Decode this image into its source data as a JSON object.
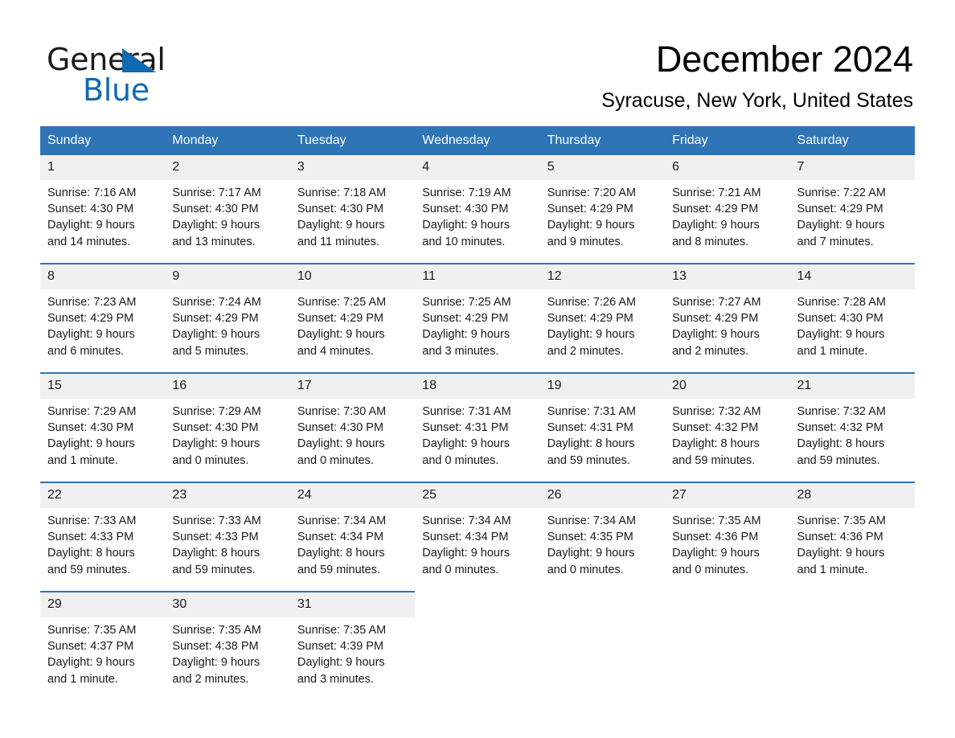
{
  "brand": {
    "name_top": "General",
    "name_bottom": "Blue",
    "triangle_color": "#1169b0",
    "text_color": "#1a1a1a"
  },
  "header": {
    "title": "December 2024",
    "subtitle": "Syracuse, New York, United States"
  },
  "theme": {
    "header_blue": "#2f74b5",
    "daynum_band": "#f0f0f0",
    "text": "#1a1a1a"
  },
  "weekday_headers": [
    "Sunday",
    "Monday",
    "Tuesday",
    "Wednesday",
    "Thursday",
    "Friday",
    "Saturday"
  ],
  "days": [
    {
      "date": "1",
      "sunrise": "Sunrise: 7:16 AM",
      "sunset": "Sunset: 4:30 PM",
      "daylight_line1": "Daylight: 9 hours",
      "daylight_line2": "and 14 minutes."
    },
    {
      "date": "2",
      "sunrise": "Sunrise: 7:17 AM",
      "sunset": "Sunset: 4:30 PM",
      "daylight_line1": "Daylight: 9 hours",
      "daylight_line2": "and 13 minutes."
    },
    {
      "date": "3",
      "sunrise": "Sunrise: 7:18 AM",
      "sunset": "Sunset: 4:30 PM",
      "daylight_line1": "Daylight: 9 hours",
      "daylight_line2": "and 11 minutes."
    },
    {
      "date": "4",
      "sunrise": "Sunrise: 7:19 AM",
      "sunset": "Sunset: 4:30 PM",
      "daylight_line1": "Daylight: 9 hours",
      "daylight_line2": "and 10 minutes."
    },
    {
      "date": "5",
      "sunrise": "Sunrise: 7:20 AM",
      "sunset": "Sunset: 4:29 PM",
      "daylight_line1": "Daylight: 9 hours",
      "daylight_line2": "and 9 minutes."
    },
    {
      "date": "6",
      "sunrise": "Sunrise: 7:21 AM",
      "sunset": "Sunset: 4:29 PM",
      "daylight_line1": "Daylight: 9 hours",
      "daylight_line2": "and 8 minutes."
    },
    {
      "date": "7",
      "sunrise": "Sunrise: 7:22 AM",
      "sunset": "Sunset: 4:29 PM",
      "daylight_line1": "Daylight: 9 hours",
      "daylight_line2": "and 7 minutes."
    },
    {
      "date": "8",
      "sunrise": "Sunrise: 7:23 AM",
      "sunset": "Sunset: 4:29 PM",
      "daylight_line1": "Daylight: 9 hours",
      "daylight_line2": "and 6 minutes."
    },
    {
      "date": "9",
      "sunrise": "Sunrise: 7:24 AM",
      "sunset": "Sunset: 4:29 PM",
      "daylight_line1": "Daylight: 9 hours",
      "daylight_line2": "and 5 minutes."
    },
    {
      "date": "10",
      "sunrise": "Sunrise: 7:25 AM",
      "sunset": "Sunset: 4:29 PM",
      "daylight_line1": "Daylight: 9 hours",
      "daylight_line2": "and 4 minutes."
    },
    {
      "date": "11",
      "sunrise": "Sunrise: 7:25 AM",
      "sunset": "Sunset: 4:29 PM",
      "daylight_line1": "Daylight: 9 hours",
      "daylight_line2": "and 3 minutes."
    },
    {
      "date": "12",
      "sunrise": "Sunrise: 7:26 AM",
      "sunset": "Sunset: 4:29 PM",
      "daylight_line1": "Daylight: 9 hours",
      "daylight_line2": "and 2 minutes."
    },
    {
      "date": "13",
      "sunrise": "Sunrise: 7:27 AM",
      "sunset": "Sunset: 4:29 PM",
      "daylight_line1": "Daylight: 9 hours",
      "daylight_line2": "and 2 minutes."
    },
    {
      "date": "14",
      "sunrise": "Sunrise: 7:28 AM",
      "sunset": "Sunset: 4:30 PM",
      "daylight_line1": "Daylight: 9 hours",
      "daylight_line2": "and 1 minute."
    },
    {
      "date": "15",
      "sunrise": "Sunrise: 7:29 AM",
      "sunset": "Sunset: 4:30 PM",
      "daylight_line1": "Daylight: 9 hours",
      "daylight_line2": "and 1 minute."
    },
    {
      "date": "16",
      "sunrise": "Sunrise: 7:29 AM",
      "sunset": "Sunset: 4:30 PM",
      "daylight_line1": "Daylight: 9 hours",
      "daylight_line2": "and 0 minutes."
    },
    {
      "date": "17",
      "sunrise": "Sunrise: 7:30 AM",
      "sunset": "Sunset: 4:30 PM",
      "daylight_line1": "Daylight: 9 hours",
      "daylight_line2": "and 0 minutes."
    },
    {
      "date": "18",
      "sunrise": "Sunrise: 7:31 AM",
      "sunset": "Sunset: 4:31 PM",
      "daylight_line1": "Daylight: 9 hours",
      "daylight_line2": "and 0 minutes."
    },
    {
      "date": "19",
      "sunrise": "Sunrise: 7:31 AM",
      "sunset": "Sunset: 4:31 PM",
      "daylight_line1": "Daylight: 8 hours",
      "daylight_line2": "and 59 minutes."
    },
    {
      "date": "20",
      "sunrise": "Sunrise: 7:32 AM",
      "sunset": "Sunset: 4:32 PM",
      "daylight_line1": "Daylight: 8 hours",
      "daylight_line2": "and 59 minutes."
    },
    {
      "date": "21",
      "sunrise": "Sunrise: 7:32 AM",
      "sunset": "Sunset: 4:32 PM",
      "daylight_line1": "Daylight: 8 hours",
      "daylight_line2": "and 59 minutes."
    },
    {
      "date": "22",
      "sunrise": "Sunrise: 7:33 AM",
      "sunset": "Sunset: 4:33 PM",
      "daylight_line1": "Daylight: 8 hours",
      "daylight_line2": "and 59 minutes."
    },
    {
      "date": "23",
      "sunrise": "Sunrise: 7:33 AM",
      "sunset": "Sunset: 4:33 PM",
      "daylight_line1": "Daylight: 8 hours",
      "daylight_line2": "and 59 minutes."
    },
    {
      "date": "24",
      "sunrise": "Sunrise: 7:34 AM",
      "sunset": "Sunset: 4:34 PM",
      "daylight_line1": "Daylight: 8 hours",
      "daylight_line2": "and 59 minutes."
    },
    {
      "date": "25",
      "sunrise": "Sunrise: 7:34 AM",
      "sunset": "Sunset: 4:34 PM",
      "daylight_line1": "Daylight: 9 hours",
      "daylight_line2": "and 0 minutes."
    },
    {
      "date": "26",
      "sunrise": "Sunrise: 7:34 AM",
      "sunset": "Sunset: 4:35 PM",
      "daylight_line1": "Daylight: 9 hours",
      "daylight_line2": "and 0 minutes."
    },
    {
      "date": "27",
      "sunrise": "Sunrise: 7:35 AM",
      "sunset": "Sunset: 4:36 PM",
      "daylight_line1": "Daylight: 9 hours",
      "daylight_line2": "and 0 minutes."
    },
    {
      "date": "28",
      "sunrise": "Sunrise: 7:35 AM",
      "sunset": "Sunset: 4:36 PM",
      "daylight_line1": "Daylight: 9 hours",
      "daylight_line2": "and 1 minute."
    },
    {
      "date": "29",
      "sunrise": "Sunrise: 7:35 AM",
      "sunset": "Sunset: 4:37 PM",
      "daylight_line1": "Daylight: 9 hours",
      "daylight_line2": "and 1 minute."
    },
    {
      "date": "30",
      "sunrise": "Sunrise: 7:35 AM",
      "sunset": "Sunset: 4:38 PM",
      "daylight_line1": "Daylight: 9 hours",
      "daylight_line2": "and 2 minutes."
    },
    {
      "date": "31",
      "sunrise": "Sunrise: 7:35 AM",
      "sunset": "Sunset: 4:39 PM",
      "daylight_line1": "Daylight: 9 hours",
      "daylight_line2": "and 3 minutes."
    }
  ]
}
